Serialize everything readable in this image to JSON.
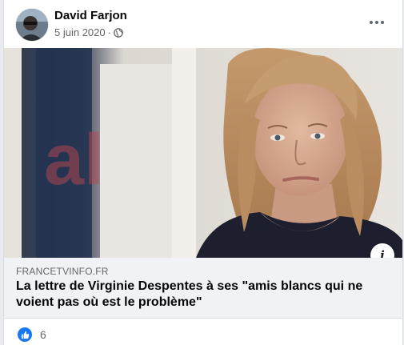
{
  "post": {
    "author": "David Farjon",
    "date": "5 juin 2020",
    "separator": "·",
    "privacy_icon": "globe-icon",
    "more_icon": "more-options-icon"
  },
  "link": {
    "domain": "FRANCETVINFO.FR",
    "title": "La lettre de Virginie Despentes à ses \"amis blancs qui ne voient pas où est le problème\"",
    "info_glyph": "i",
    "image_alt": "Photo of a woman with shoulder-length blonde hair"
  },
  "reactions": {
    "icon": "like-icon",
    "count": "6"
  },
  "colors": {
    "accent": "#1877f2",
    "link_box_bg": "#f0f2f5",
    "secondary_text": "#65676b"
  }
}
